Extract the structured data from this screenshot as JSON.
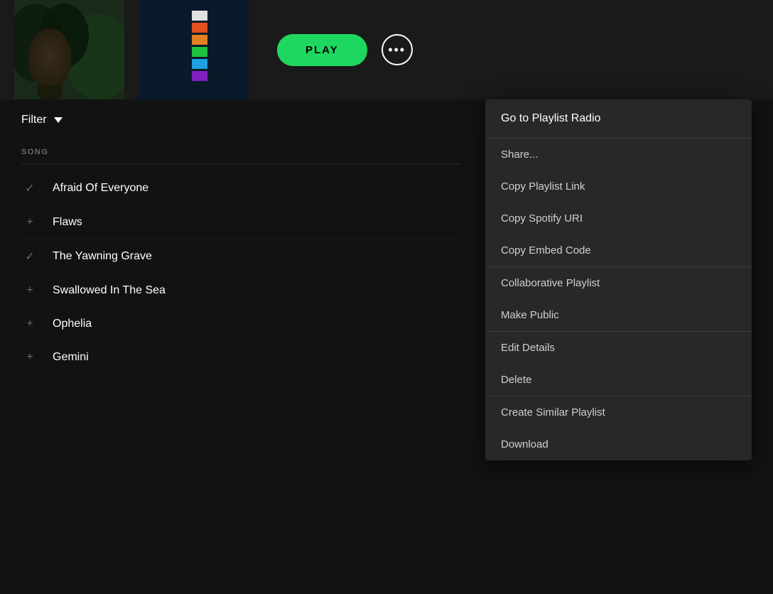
{
  "header": {
    "play_label": "PLAY",
    "more_dots": "···"
  },
  "filter": {
    "label": "Filter"
  },
  "song_column": {
    "header": "SONG"
  },
  "songs": [
    {
      "id": 1,
      "name": "Afraid Of Everyone",
      "icon": "check"
    },
    {
      "id": 2,
      "name": "Flaws",
      "icon": "plus"
    },
    {
      "id": 3,
      "name": "The Yawning Grave",
      "icon": "check"
    },
    {
      "id": 4,
      "name": "Swallowed In The Sea",
      "icon": "plus"
    },
    {
      "id": 5,
      "name": "Ophelia",
      "icon": "plus"
    },
    {
      "id": 6,
      "name": "Gemini",
      "icon": "plus"
    }
  ],
  "context_menu": {
    "sections": [
      {
        "id": "radio",
        "items": [
          {
            "id": "go-to-playlist-radio",
            "label": "Go to Playlist Radio"
          }
        ]
      },
      {
        "id": "share",
        "items": [
          {
            "id": "share",
            "label": "Share..."
          },
          {
            "id": "copy-playlist-link",
            "label": "Copy Playlist Link"
          },
          {
            "id": "copy-spotify-uri",
            "label": "Copy Spotify URI"
          },
          {
            "id": "copy-embed-code",
            "label": "Copy Embed Code"
          }
        ]
      },
      {
        "id": "collab",
        "items": [
          {
            "id": "collaborative-playlist",
            "label": "Collaborative Playlist"
          },
          {
            "id": "make-public",
            "label": "Make Public"
          }
        ]
      },
      {
        "id": "edit",
        "items": [
          {
            "id": "edit-details",
            "label": "Edit Details"
          },
          {
            "id": "delete",
            "label": "Delete"
          }
        ]
      },
      {
        "id": "create",
        "items": [
          {
            "id": "create-similar-playlist",
            "label": "Create Similar Playlist"
          },
          {
            "id": "download",
            "label": "Download"
          }
        ]
      }
    ]
  },
  "colors": {
    "green": "#1ed760",
    "dark_bg": "#121212",
    "menu_bg": "#282828",
    "text_primary": "#ffffff",
    "text_secondary": "#d0d0d0",
    "text_muted": "#6a6a6a"
  }
}
